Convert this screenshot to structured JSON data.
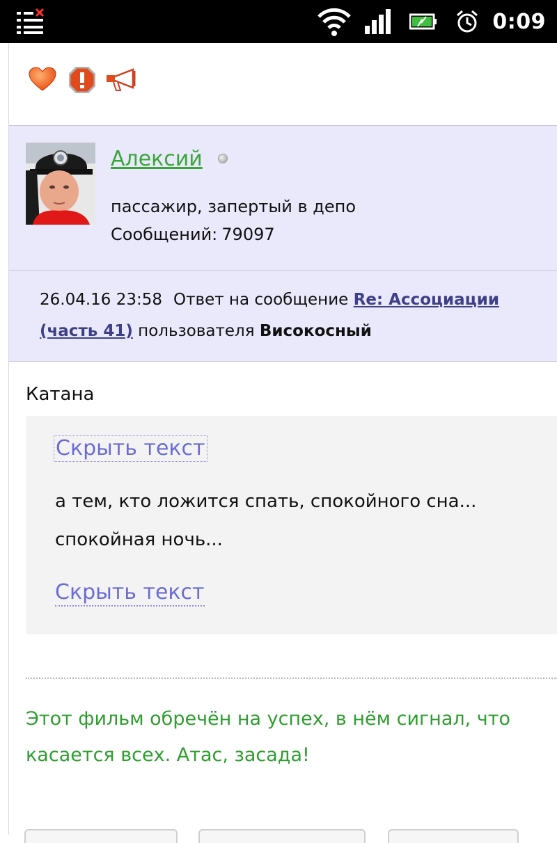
{
  "status_bar": {
    "time": "0:09",
    "icons": [
      "notification-list-icon",
      "wifi-icon",
      "signal-icon",
      "battery-icon",
      "alarm-icon"
    ]
  },
  "post": {
    "actions": [
      "heart-icon",
      "report-icon",
      "megaphone-icon"
    ],
    "author": {
      "name": "Алексий",
      "status": "пассажир, запертый в депо",
      "messages_label": "Сообщений:",
      "messages_count": "79097"
    },
    "reply": {
      "date": "26.04.16 23:58",
      "prefix": "Ответ на сообщение",
      "topic_link": "Re: Ассоциации",
      "part_link": "(часть 41)",
      "by": "пользователя",
      "user": "Високосный"
    },
    "title": "Катана",
    "spoiler": {
      "hide_label_top": "Скрыть текст",
      "text_line1": "а тем, кто ложится спать, спокойного сна...",
      "text_line2": "спокойная ночь...",
      "hide_label_bottom": "Скрыть текст"
    },
    "signature": {
      "line1": "Этот фильм обречён на успех, в нём сигнал, что",
      "line2": "касается всех. Атас, засада!"
    }
  },
  "colors": {
    "author_bg": "#e9e9fb",
    "author_name": "#3aa63a",
    "link": "#3f3f88",
    "spoiler_link": "#6b6bd6",
    "signature": "#2e9e2e"
  }
}
